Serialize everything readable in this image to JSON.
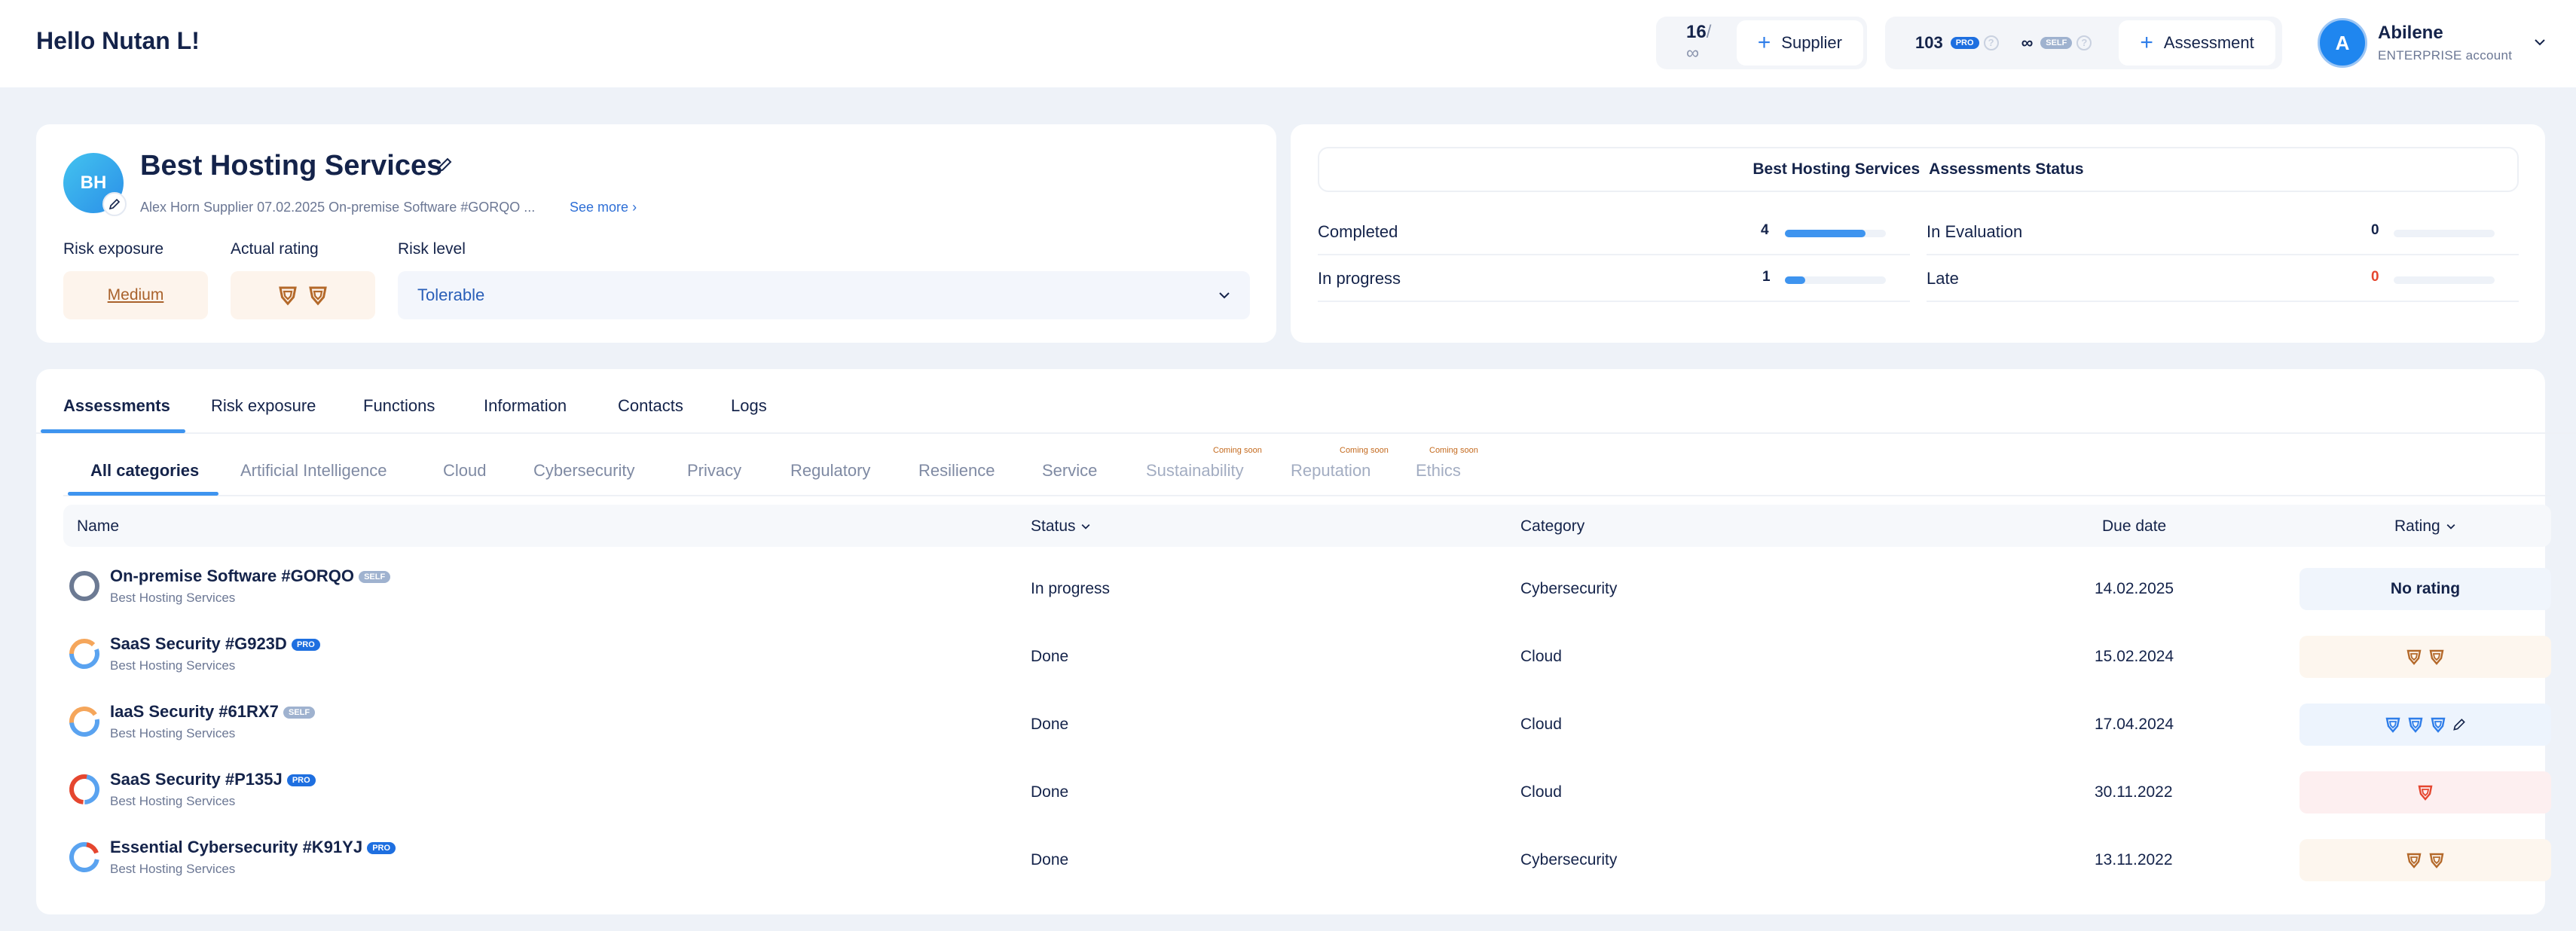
{
  "header": {
    "greeting": "Hello Nutan L!",
    "supplier_count": "16",
    "supplier_limit": "/∞",
    "add_supplier_label": "Supplier",
    "credits": "103",
    "pro_badge": "PRO",
    "self_credits": "∞",
    "self_badge": "SELF",
    "add_assessment_label": "Assessment",
    "user": {
      "initial": "A",
      "name": "Abilene",
      "plan": "ENTERPRISE account"
    }
  },
  "supplier": {
    "initials": "BH",
    "name": "Best Hosting Services",
    "meta": "Alex Horn Supplier 07.02.2025 On-premise Software #GORQO ...",
    "see_more": "See more",
    "risk_exposure_label": "Risk exposure",
    "risk_exposure_value": "Medium",
    "actual_rating_label": "Actual rating",
    "risk_level_label": "Risk level",
    "risk_level_value": "Tolerable"
  },
  "status_card": {
    "supplier_name": "Best Hosting Services",
    "title": "Assessments Status",
    "stats": [
      {
        "label": "Completed",
        "value": "4",
        "fraction": 0.8
      },
      {
        "label": "In progress",
        "value": "1",
        "fraction": 0.2
      },
      {
        "label": "In Evaluation",
        "value": "0",
        "fraction": 0
      },
      {
        "label": "Late",
        "value": "0",
        "fraction": 0
      }
    ]
  },
  "tabs": [
    "Assessments",
    "Risk exposure",
    "Functions",
    "Information",
    "Contacts",
    "Logs"
  ],
  "categories": [
    {
      "label": "All categories"
    },
    {
      "label": "Artificial Intelligence"
    },
    {
      "label": "Cloud"
    },
    {
      "label": "Cybersecurity"
    },
    {
      "label": "Privacy"
    },
    {
      "label": "Regulatory"
    },
    {
      "label": "Resilience"
    },
    {
      "label": "Service"
    },
    {
      "label": "Sustainability",
      "note": "Coming soon"
    },
    {
      "label": "Reputation",
      "note": "Coming soon"
    },
    {
      "label": "Ethics",
      "note": "Coming soon"
    }
  ],
  "table": {
    "columns": {
      "name": "Name",
      "status": "Status",
      "category": "Category",
      "due": "Due date",
      "rating": "Rating"
    },
    "rows": [
      {
        "name": "On-premise Software #GORQO",
        "badge": "SELF",
        "supplier": "Best Hosting Services",
        "status": "In progress",
        "category": "Cybersecurity",
        "due": "14.02.2025",
        "rating": "No rating"
      },
      {
        "name": "SaaS Security #G923D",
        "badge": "PRO",
        "supplier": "Best Hosting Services",
        "status": "Done",
        "category": "Cloud",
        "due": "15.02.2024"
      },
      {
        "name": "IaaS Security #61RX7",
        "badge": "SELF",
        "supplier": "Best Hosting Services",
        "status": "Done",
        "category": "Cloud",
        "due": "17.04.2024"
      },
      {
        "name": "SaaS Security #P135J",
        "badge": "PRO",
        "supplier": "Best Hosting Services",
        "status": "Done",
        "category": "Cloud",
        "due": "30.11.2022"
      },
      {
        "name": "Essential Cybersecurity #K91YJ",
        "badge": "PRO",
        "supplier": "Best Hosting Services",
        "status": "Done",
        "category": "Cybersecurity",
        "due": "13.11.2022"
      }
    ]
  },
  "colors": {
    "accent": "#3e94ef",
    "medium": "#a9622c",
    "late": "#e5462f",
    "shield_bronze": "#b4692a",
    "shield_blue": "#2e7de9",
    "shield_red": "#e5462f"
  }
}
